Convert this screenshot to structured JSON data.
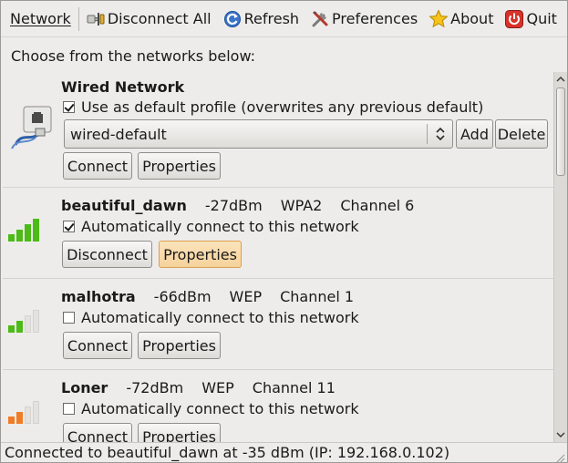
{
  "toolbar": {
    "network_label": "Network",
    "disconnect_all_label": "Disconnect All",
    "refresh_label": "Refresh",
    "preferences_label": "Preferences",
    "about_label": "About",
    "quit_label": "Quit"
  },
  "heading": "Choose from the networks below:",
  "wired": {
    "title": "Wired Network",
    "default_profile_label": "Use as default profile (overwrites any previous default)",
    "default_profile_checked": true,
    "profile_value": "wired-default",
    "add_label": "Add",
    "delete_label": "Delete",
    "connect_label": "Connect",
    "properties_label": "Properties"
  },
  "networks": [
    {
      "name": "beautiful_dawn",
      "signal": "-27dBm",
      "encryption": "WPA2",
      "channel": "Channel 6",
      "auto_label": "Automatically connect to this network",
      "auto_checked": true,
      "action_label": "Disconnect",
      "properties_label": "Properties",
      "signal_level": 4,
      "signal_color": "#4cbb17"
    },
    {
      "name": "malhotra",
      "signal": "-66dBm",
      "encryption": "WEP",
      "channel": "Channel 1",
      "auto_label": "Automatically connect to this network",
      "auto_checked": false,
      "action_label": "Connect",
      "properties_label": "Properties",
      "signal_level": 2,
      "signal_color": "#4cbb17"
    },
    {
      "name": "Loner",
      "signal": "-72dBm",
      "encryption": "WEP",
      "channel": "Channel 11",
      "auto_label": "Automatically connect to this network",
      "auto_checked": false,
      "action_label": "Connect",
      "properties_label": "Properties",
      "signal_level": 2,
      "signal_color": "#f07c28"
    }
  ],
  "status": "Connected to beautiful_dawn at -35 dBm (IP: 192.168.0.102)",
  "colors": {
    "window_bg": "#edeceb",
    "hot_button": "#f6d29b",
    "signal_green": "#4cbb17",
    "signal_orange": "#f07c28",
    "signal_empty": "#e3e2df"
  },
  "icons": {
    "disconnect_all": "plug-icon",
    "refresh": "refresh-icon",
    "preferences": "tools-icon",
    "about": "star-icon",
    "quit": "power-icon",
    "wired": "wired-network-icon",
    "signal": "signal-strength-icon"
  }
}
